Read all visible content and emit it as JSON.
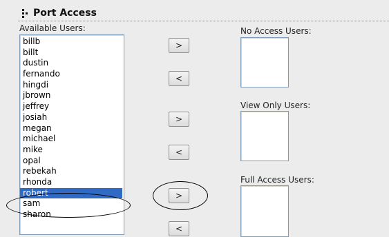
{
  "section": {
    "title": "Port Access"
  },
  "available": {
    "label": "Available Users:",
    "users": [
      "billb",
      "billt",
      "dustin",
      "fernando",
      "hingdi",
      "jbrown",
      "jeffrey",
      "josiah",
      "megan",
      "michael",
      "mike",
      "opal",
      "rebekah",
      "rhonda",
      "robert",
      "sam",
      "sharon"
    ],
    "selected": "robert"
  },
  "buttons": {
    "add_label": ">",
    "remove_label": "<"
  },
  "no_access": {
    "label": "No Access Users:"
  },
  "view_only": {
    "label": "View Only Users:"
  },
  "full_access": {
    "label": "Full Access Users:"
  },
  "colors": {
    "selection": "#316ac5",
    "list_border": "#7f9db9"
  }
}
